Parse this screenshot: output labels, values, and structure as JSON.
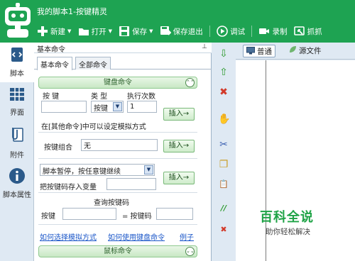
{
  "app": {
    "title": "我的脚本1-按键精灵",
    "brand_color": "#1ea352"
  },
  "toolbar": [
    {
      "id": "new",
      "label": "新建",
      "icon": "plus-icon",
      "dropdown": true
    },
    {
      "id": "open",
      "label": "打开",
      "icon": "folder-icon",
      "dropdown": true
    },
    {
      "id": "save",
      "label": "保存",
      "icon": "floppy-icon",
      "dropdown": true
    },
    {
      "id": "save_exit",
      "label": "保存退出",
      "icon": "floppy-exit-icon",
      "dropdown": false
    },
    {
      "id": "debug",
      "label": "调试",
      "icon": "play-icon",
      "dropdown": false
    },
    {
      "id": "record",
      "label": "录制",
      "icon": "camera-icon",
      "dropdown": false
    },
    {
      "id": "capture",
      "label": "抓抓",
      "icon": "capture-icon",
      "dropdown": false
    }
  ],
  "leftnav": [
    {
      "id": "script",
      "label": "脚本",
      "icon": "script-icon",
      "active": true
    },
    {
      "id": "ui",
      "label": "界面",
      "icon": "grid-icon",
      "active": false
    },
    {
      "id": "attach",
      "label": "附件",
      "icon": "paperclip-icon",
      "active": false
    },
    {
      "id": "props",
      "label": "脚本属性",
      "icon": "info-icon",
      "active": false
    }
  ],
  "panel": {
    "title": "基本命令",
    "pin_glyph": "⊥",
    "tabs": [
      {
        "label": "基本命令",
        "active": true
      },
      {
        "label": "全部命令",
        "active": false
      }
    ],
    "keyboard": {
      "header": "键盘命令",
      "col_key": "按 键",
      "col_type": "类 型",
      "col_count": "执行次数",
      "key_value": "",
      "type_value": "按键",
      "count_value": "1",
      "insert": "插入→",
      "note": "在[其他命令]中可以设定模拟方式",
      "combo_label": "按键组合",
      "combo_value": "无",
      "pause_value": "脚本暂停，按任意键继续",
      "store_label": "把按键码存入变量",
      "store_value": "",
      "query_title": "查询按键码",
      "query_key_label": "按键",
      "query_key_value": "",
      "query_code_label": "= 按键码",
      "query_code_value": ""
    },
    "links": [
      "如何选择模拟方式",
      "如何使用键盘命令",
      "例子"
    ],
    "mouse_header": "鼠标命令"
  },
  "tools": [
    {
      "icon": "arrow-down-icon",
      "glyph": "⇩",
      "color": "#2c9a2c"
    },
    {
      "icon": "arrow-up-icon",
      "glyph": "⇧",
      "color": "#2c9a2c"
    },
    {
      "icon": "delete-icon",
      "glyph": "✖",
      "color": "#d23a2a"
    },
    {
      "icon": "hand-icon",
      "glyph": "✋",
      "color": "#c98a2a"
    },
    {
      "icon": "cut-icon",
      "glyph": "✂",
      "color": "#3a5fb0"
    },
    {
      "icon": "copy-icon",
      "glyph": "❐",
      "color": "#c9a02a"
    },
    {
      "icon": "paste-icon",
      "glyph": "📋",
      "color": "#8a6a3a"
    },
    {
      "icon": "comment-icon",
      "glyph": "//",
      "color": "#2c9a2c"
    },
    {
      "icon": "uncomment-icon",
      "glyph": "✖",
      "color": "#d23a2a"
    }
  ],
  "editor": {
    "tabs": [
      {
        "label": "普通",
        "icon": "monitor-icon",
        "active": true
      },
      {
        "label": "源文件",
        "icon": "leaf-icon",
        "active": false
      }
    ]
  },
  "watermark": {
    "title": "百科全说",
    "subtitle": "助你轻松解决"
  }
}
